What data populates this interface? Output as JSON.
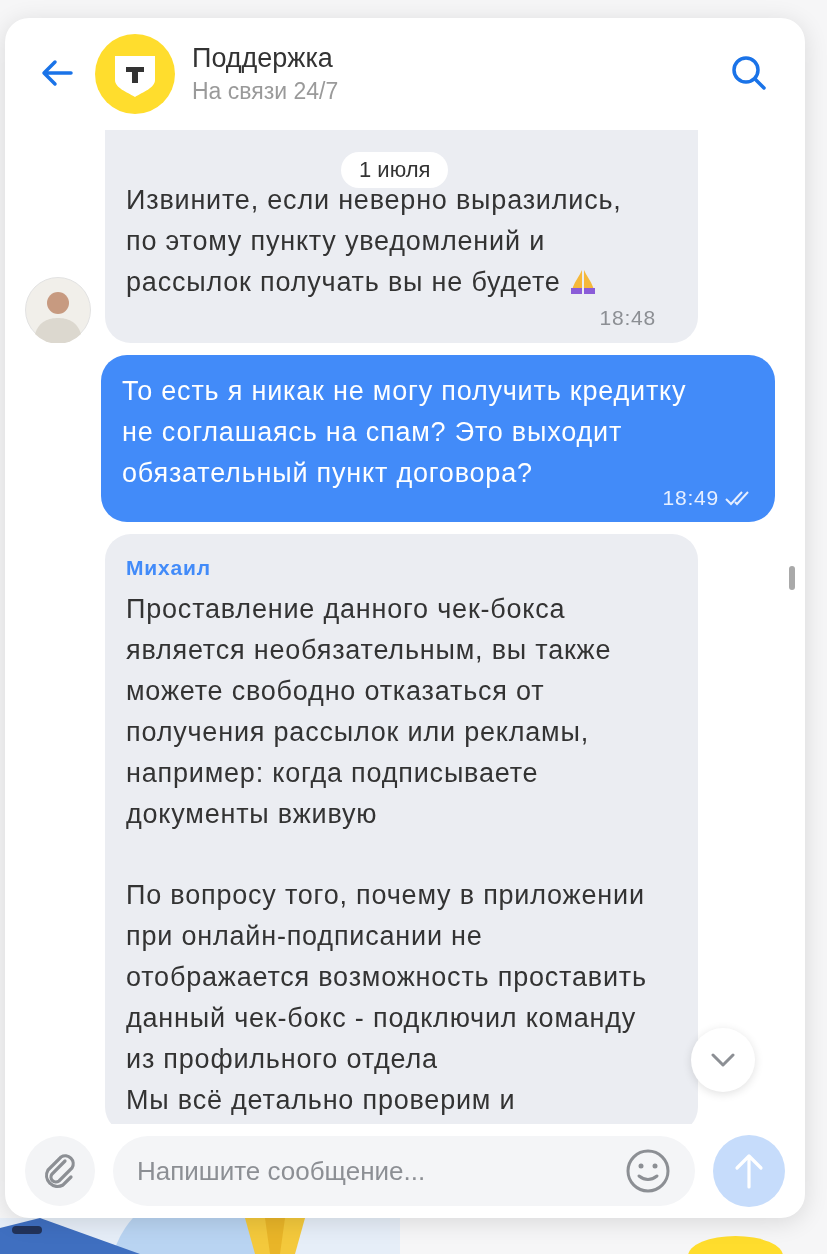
{
  "header": {
    "title": "Поддержка",
    "status": "На связи 24/7"
  },
  "date_label": "1 июля",
  "messages": [
    {
      "kind": "incoming",
      "show_avatar": true,
      "paragraphs": [
        "Извините, если неверно выразились, по этому пункту уведомлений и рассылок получать вы не будете"
      ],
      "has_emoji": true,
      "time": "18:48"
    },
    {
      "kind": "outgoing",
      "paragraphs": [
        "То есть я никак не могу получить кредитку не соглашаясь на спам? Это выходит обязательный пункт договора?"
      ],
      "time": "18:49",
      "read": true
    },
    {
      "kind": "incoming",
      "show_avatar": false,
      "sender": "Михаил",
      "paragraphs": [
        "Проставление данного чек-бокса является необязательным, вы также можете свободно отказаться от получения рассылок или рекламы, например: когда подписываете документы вживую",
        "По вопросу того, почему в приложении при онлайн-подписании не отображается возможность проставить данный чек-бокс - подключил команду из профильного отдела\nМы всё детально проверим и"
      ]
    }
  ],
  "composer": {
    "placeholder": "Напишите сообщение...",
    "send_disabled": true
  }
}
